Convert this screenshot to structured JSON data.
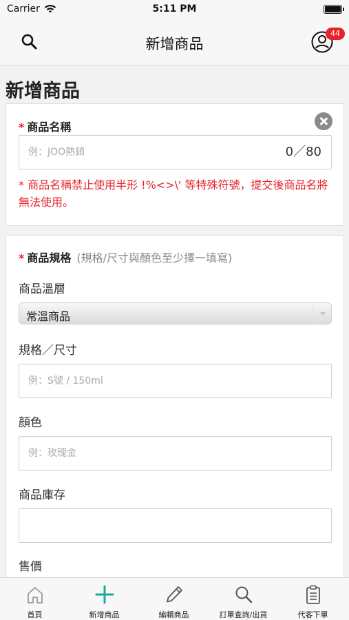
{
  "status_bar": {
    "carrier": "Carrier",
    "time": "5:11 PM"
  },
  "nav": {
    "title": "新增商品",
    "badge_count": "44",
    "icons": {
      "left": "search-icon",
      "right": "user-profile-icon"
    }
  },
  "page": {
    "heading": "新增商品"
  },
  "product_name_section": {
    "required_mark": "*",
    "label": "商品名稱",
    "input_placeholder": "例：JOO熱銷",
    "counter": "0／80",
    "error_message": "* 商品名稱禁止使用半形 !%<>\\' 等特殊符號，提交後商品名將無法使用。"
  },
  "spec_section": {
    "required_mark": "*",
    "label": "商品規格",
    "hint": "(規格/尺寸與顏色至少擇一填寫)",
    "temperature": {
      "label": "商品溫層",
      "selected": "常溫商品"
    },
    "size": {
      "label": "規格／尺寸",
      "placeholder": "例：S號 / 150ml"
    },
    "color": {
      "label": "顏色",
      "placeholder": "例：玫瑰金"
    },
    "stock": {
      "label": "商品庫存",
      "placeholder": ""
    },
    "price": {
      "label": "售價"
    }
  },
  "tab_bar": {
    "tabs": [
      {
        "label": "首頁",
        "icon": "home-icon"
      },
      {
        "label": "新增商品",
        "icon": "plus-icon"
      },
      {
        "label": "編輯商品",
        "icon": "pencil-icon"
      },
      {
        "label": "訂單查詢/出貨",
        "icon": "search-icon"
      },
      {
        "label": "代客下單",
        "icon": "clipboard-icon"
      }
    ]
  },
  "colors": {
    "accent_teal": "#1aa99a",
    "error_red": "#e8232a",
    "badge_red": "#e8232a"
  }
}
